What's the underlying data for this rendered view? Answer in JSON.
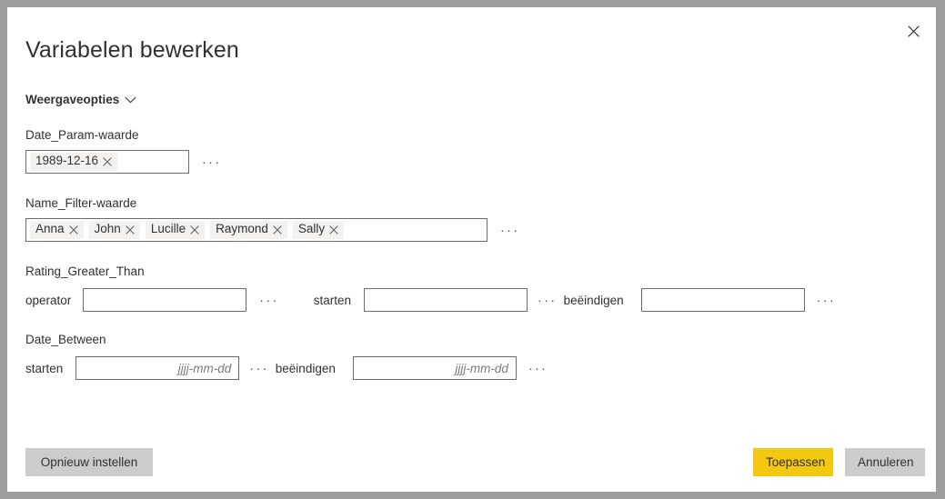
{
  "dialog": {
    "title": "Variabelen bewerken",
    "close_label": "×"
  },
  "display_options": {
    "label": "Weergaveopties"
  },
  "fields": {
    "date_param": {
      "label": "Date_Param-waarde",
      "tokens": [
        {
          "text": "1989-12-16"
        }
      ],
      "ellipsis": "···"
    },
    "name_filter": {
      "label": "Name_Filter-waarde",
      "tokens": [
        {
          "text": "Anna"
        },
        {
          "text": "John"
        },
        {
          "text": "Lucille"
        },
        {
          "text": "Raymond"
        },
        {
          "text": "Sally"
        }
      ],
      "ellipsis": "···"
    },
    "rating_greater_than": {
      "label": "Rating_Greater_Than",
      "operator_label": "operator",
      "operator_value": "",
      "operator_ellipsis": "···",
      "start_label": "starten",
      "start_value": "",
      "start_ellipsis": "···",
      "end_label": "beëindigen",
      "end_value": "",
      "end_ellipsis": "···"
    },
    "date_between": {
      "label": "Date_Between",
      "start_label": "starten",
      "start_value": "",
      "start_placeholder_underlined": "jjjj",
      "start_placeholder_rest": "-mm-dd",
      "start_ellipsis": "···",
      "end_label": "beëindigen",
      "end_value": "",
      "end_placeholder_underlined": "jjjj",
      "end_placeholder_rest": "-mm-dd",
      "end_ellipsis": "···"
    }
  },
  "footer": {
    "reset_label": "Opnieuw instellen",
    "apply_label": "Toepassen",
    "cancel_label": "Annuleren"
  },
  "colors": {
    "accent_yellow": "#f2c811",
    "button_gray": "#cccccc",
    "token_bg": "#f3f2f1",
    "backdrop": "#9e9e9e",
    "text": "#323130"
  }
}
